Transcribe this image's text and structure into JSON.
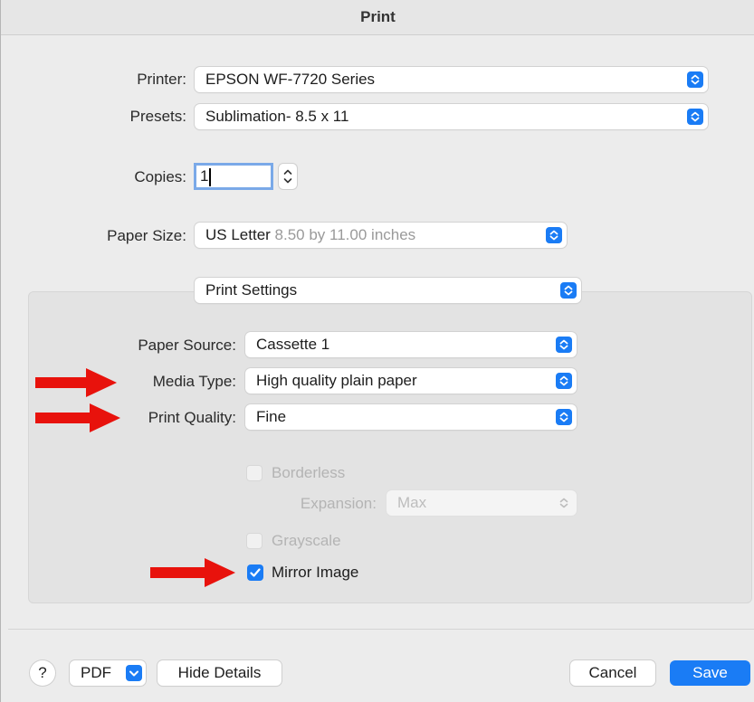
{
  "dialog": {
    "title": "Print"
  },
  "printer": {
    "label": "Printer:",
    "value": "EPSON WF-7720 Series"
  },
  "presets": {
    "label": "Presets:",
    "value": "Sublimation- 8.5 x 11"
  },
  "copies": {
    "label": "Copies:",
    "value": "1"
  },
  "paper_size": {
    "label": "Paper Size:",
    "value": "US Letter",
    "detail": "8.50 by 11.00 inches"
  },
  "section": {
    "value": "Print Settings"
  },
  "paper_source": {
    "label": "Paper Source:",
    "value": "Cassette 1"
  },
  "media_type": {
    "label": "Media Type:",
    "value": "High quality plain paper"
  },
  "print_quality": {
    "label": "Print Quality:",
    "value": "Fine"
  },
  "borderless": {
    "label": "Borderless",
    "checked": false,
    "enabled": false
  },
  "expansion": {
    "label": "Expansion:",
    "value": "Max",
    "enabled": false
  },
  "grayscale": {
    "label": "Grayscale",
    "checked": false,
    "enabled": false
  },
  "mirror_image": {
    "label": "Mirror Image",
    "checked": true,
    "enabled": true
  },
  "footer": {
    "help_label": "?",
    "pdf_label": "PDF",
    "hide_details_label": "Hide Details",
    "cancel_label": "Cancel",
    "save_label": "Save"
  },
  "colors": {
    "accent": "#1a7cf5",
    "annotation_arrow": "#e8120c"
  },
  "icons": {
    "popup": "up-down-chevron-icon",
    "stepper": "stepper-icon",
    "pdf_menu": "chevron-down-icon",
    "annotation": "red-arrow-icon",
    "check": "checkmark-icon"
  }
}
